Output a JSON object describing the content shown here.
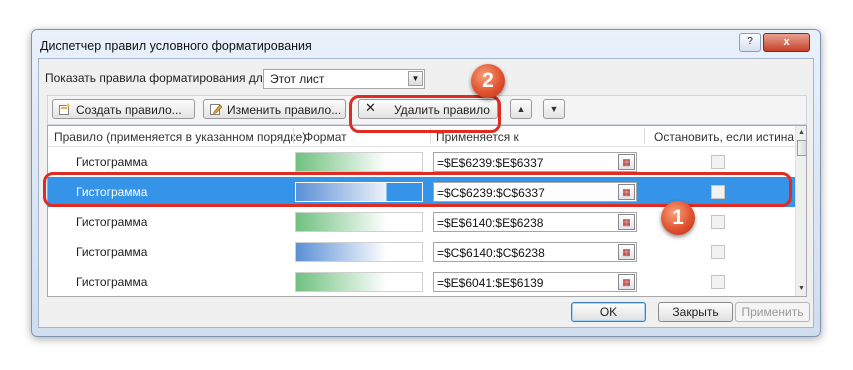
{
  "window": {
    "title": "Диспетчер правил условного форматирования",
    "help_label": "?",
    "close_label": "x"
  },
  "filter": {
    "label": "Показать правила форматирования для:",
    "value": "Этот лист"
  },
  "toolbar": {
    "create": "Создать правило...",
    "edit": "Изменить правило...",
    "delete": "Удалить правило",
    "move_up": "▲",
    "move_down": "▼"
  },
  "columns": {
    "rule": "Правило (применяется в указанном порядке)",
    "format": "Формат",
    "applies": "Применяется к",
    "stop": "Остановить, если истина"
  },
  "rows": [
    {
      "name": "Гистограмма",
      "range": "=$E$6239:$E$6337",
      "color": "#6fc07f",
      "selected": false,
      "stop_if_true": false
    },
    {
      "name": "Гистограмма",
      "range": "=$C$6239:$C$6337",
      "color": "#5b8fd6",
      "selected": true,
      "stop_if_true": false
    },
    {
      "name": "Гистограмма",
      "range": "=$E$6140:$E$6238",
      "color": "#6fc07f",
      "selected": false,
      "stop_if_true": false
    },
    {
      "name": "Гистограмма",
      "range": "=$C$6140:$C$6238",
      "color": "#5b8fd6",
      "selected": false,
      "stop_if_true": false
    },
    {
      "name": "Гистограмма",
      "range": "=$E$6041:$E$6139",
      "color": "#6fc07f",
      "selected": false,
      "stop_if_true": false
    }
  ],
  "footer": {
    "ok": "OK",
    "close": "Закрыть",
    "apply": "Применить"
  },
  "annotations": {
    "badge1": "1",
    "badge2": "2",
    "highlight_color": "#df2b21"
  }
}
